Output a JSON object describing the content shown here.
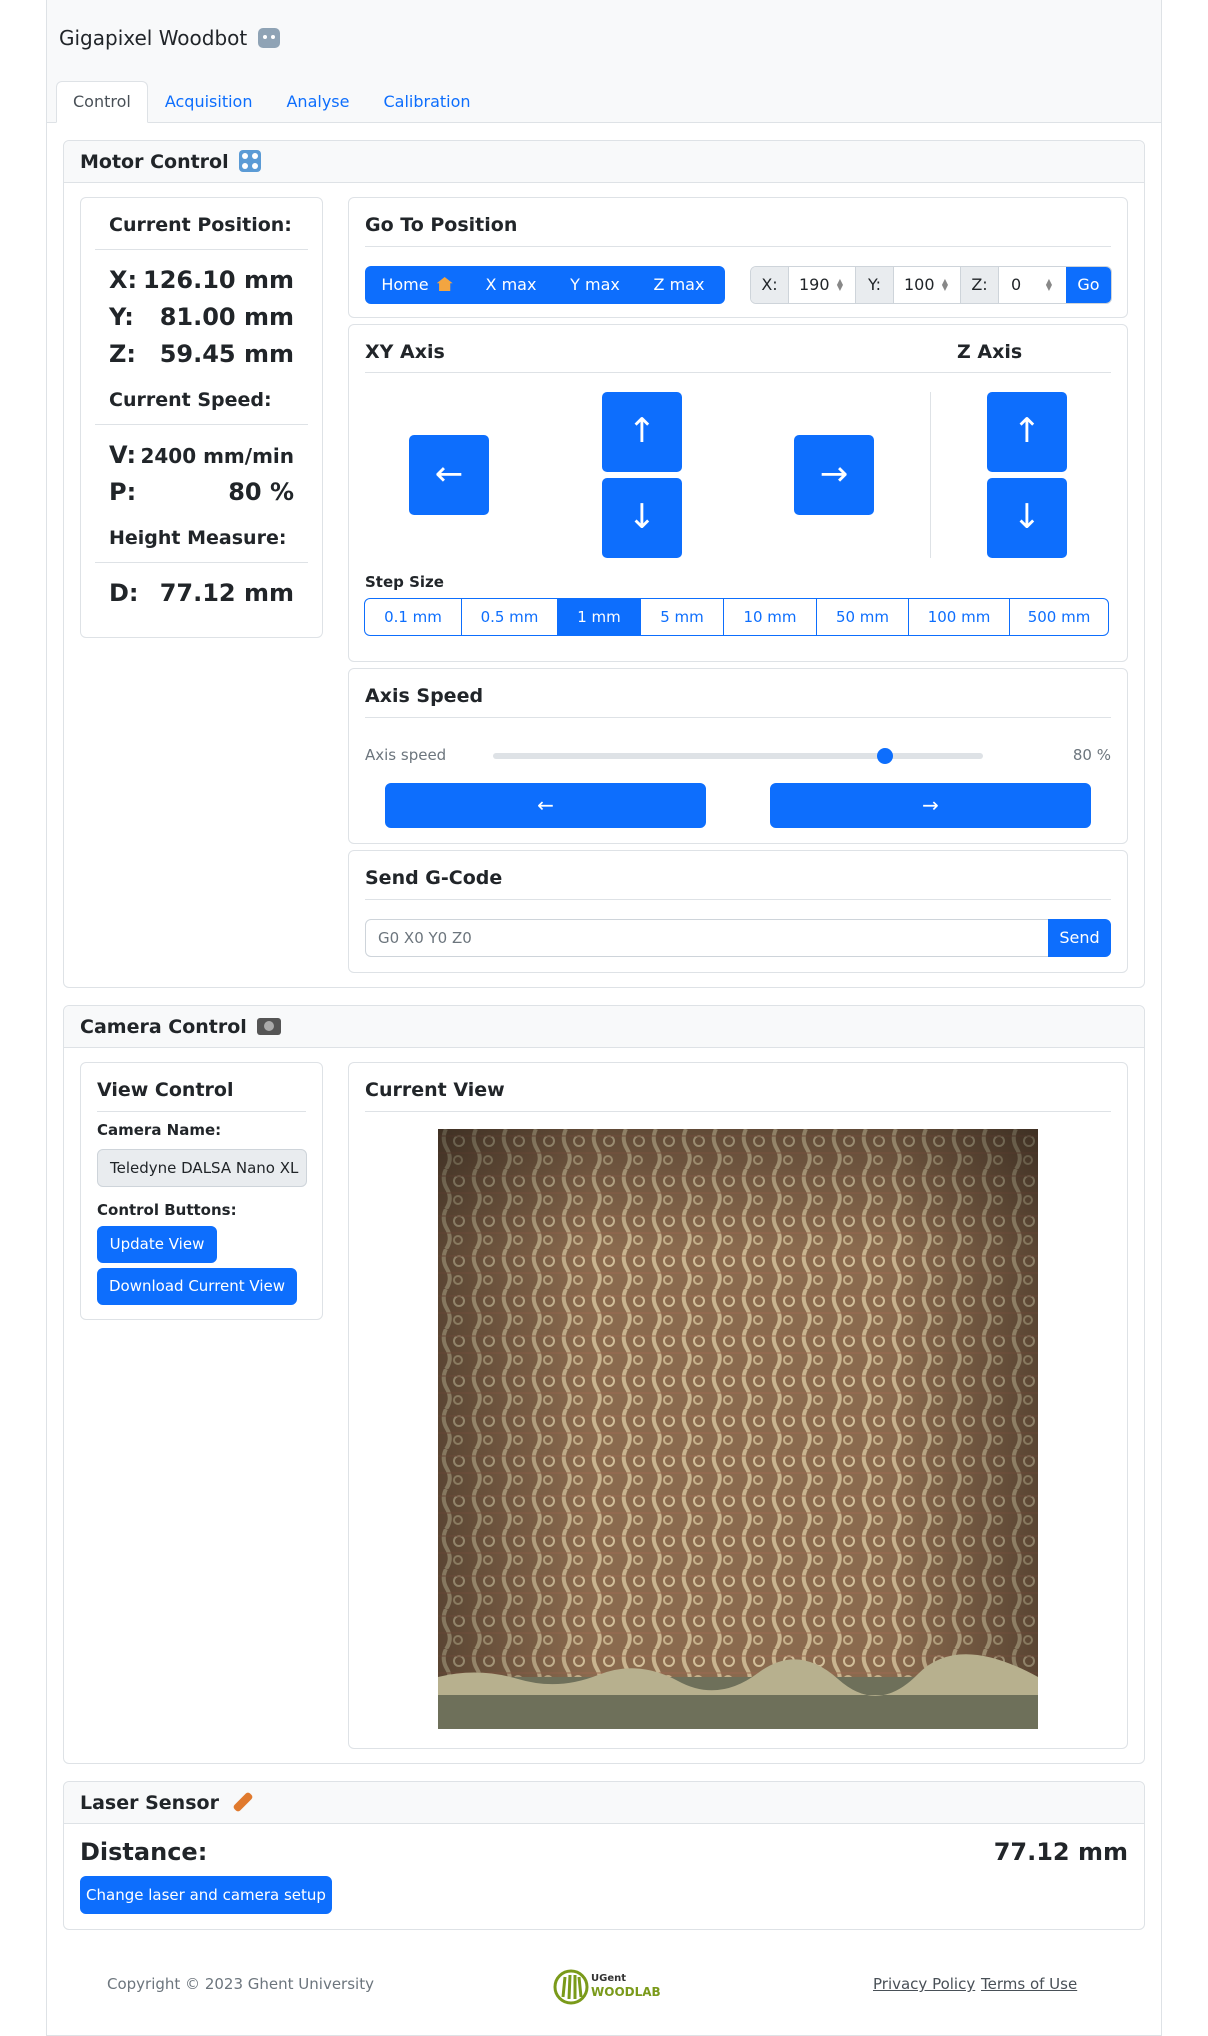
{
  "app": {
    "title": "Gigapixel Woodbot",
    "title_icon": "robot-icon"
  },
  "tabs": [
    {
      "label": "Control",
      "active": true
    },
    {
      "label": "Acquisition",
      "active": false
    },
    {
      "label": "Analyse",
      "active": false
    },
    {
      "label": "Calibration",
      "active": false
    }
  ],
  "motor_control": {
    "header": "Motor Control",
    "header_icon": "control-knobs-icon",
    "position": {
      "title": "Current Position:",
      "x_label": "X:",
      "x_value": "126.10 mm",
      "y_label": "Y:",
      "y_value": "81.00 mm",
      "z_label": "Z:",
      "z_value": "59.45 mm"
    },
    "speed": {
      "title": "Current Speed:",
      "v_label": "V:",
      "v_value": "2400 mm/min",
      "p_label": "P:",
      "p_value": "80 %"
    },
    "height": {
      "title": "Height Measure:",
      "d_label": "D:",
      "d_value": "77.12 mm"
    },
    "goto": {
      "title": "Go To Position",
      "home_label": "Home",
      "home_icon": "house-icon",
      "xmax_label": "X max",
      "ymax_label": "Y max",
      "zmax_label": "Z max",
      "x_label": "X:",
      "x_value": "190",
      "y_label": "Y:",
      "y_value": "100",
      "z_label": "Z:",
      "z_value": "0",
      "go_label": "Go"
    },
    "axis": {
      "xy_title": "XY Axis",
      "z_title": "Z Axis",
      "left_arrow": "←",
      "right_arrow": "→",
      "up_arrow": "↑",
      "down_arrow": "↓",
      "step_title": "Step Size",
      "steps": [
        "0.1 mm",
        "0.5 mm",
        "1 mm",
        "5 mm",
        "10 mm",
        "50 mm",
        "100 mm",
        "500 mm"
      ],
      "selected_step": "1 mm"
    },
    "axis_speed": {
      "title": "Axis Speed",
      "label": "Axis speed",
      "value": 80,
      "value_text": "80 %",
      "left_arrow": "←",
      "right_arrow": "→"
    },
    "gcode": {
      "title": "Send G-Code",
      "placeholder": "G0 X0 Y0 Z0",
      "send_label": "Send"
    }
  },
  "camera_control": {
    "header": "Camera Control",
    "header_icon": "camera-icon",
    "view_control": {
      "title": "View Control",
      "camera_name_label": "Camera Name:",
      "camera_name_value": "Teledyne DALSA Nano XL",
      "buttons_label": "Control Buttons:",
      "update_label": "Update View",
      "download_label": "Download Current View"
    },
    "current_view": {
      "title": "Current View",
      "image_name": "wood-cross-section-image"
    }
  },
  "laser_sensor": {
    "header": "Laser Sensor",
    "header_icon": "flashlight-icon",
    "distance_label": "Distance:",
    "distance_value": "77.12 mm",
    "setup_button": "Change laser and camera setup"
  },
  "footer": {
    "copyright": "Copyright © 2023 Ghent University",
    "logo_line1": "UGent",
    "logo_line2": "WOODLAB",
    "privacy": "Privacy Policy",
    "terms": "Terms of Use"
  },
  "colors": {
    "primary": "#0d6efd",
    "border": "#dee2e6",
    "header_bg": "#f8f9fa",
    "logo_green": "#7a9a1a"
  }
}
